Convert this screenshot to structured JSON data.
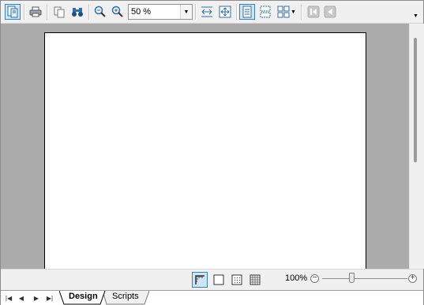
{
  "toolbar": {
    "zoom_value": "50 %",
    "buttons": [
      "design-mode",
      "print",
      "copy",
      "find",
      "zoom-in",
      "zoom-out",
      "fit-width",
      "fit-page",
      "single-page",
      "continuous",
      "multi-page",
      "first-page",
      "previous-page"
    ]
  },
  "statusbar": {
    "zoom_percent": "100%",
    "zoom_slider_level": 0.35
  },
  "tabs": {
    "design_label": "Design",
    "scripts_label": "Scripts"
  },
  "colors": {
    "accent": "#3c7fb1",
    "active_fill": "#cde6f7",
    "canvas_bg": "#ababab",
    "paper": "#ffffff"
  }
}
